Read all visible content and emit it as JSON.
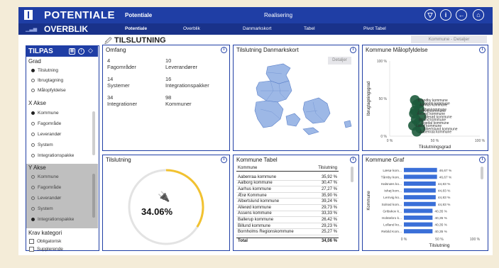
{
  "header": {
    "app_title": "POTENTIALE",
    "tabs": [
      {
        "label": "Potentiale",
        "active": true
      },
      {
        "label": "Realisering",
        "active": false
      }
    ],
    "icons": [
      "filter-icon",
      "info-icon",
      "back-icon",
      "home-icon"
    ]
  },
  "subheader": {
    "title": "OVERBLIK",
    "tabs": [
      {
        "label": "Potentiale",
        "active": true
      },
      {
        "label": "Overblik",
        "active": false
      },
      {
        "label": "Danmarkskort",
        "active": false
      },
      {
        "label": "Tabel",
        "active": false
      },
      {
        "label": "Pivot Tabel",
        "active": false
      }
    ]
  },
  "kommune_detaljer_label": "Kommune - Detaljer",
  "section_title": "TILSLUTNING",
  "sidebar": {
    "title": "TILPAS",
    "grad": {
      "title": "Grad",
      "options": [
        {
          "label": "Tilslutning",
          "selected": true
        },
        {
          "label": "Ibrugtagning",
          "selected": false
        },
        {
          "label": "Målopfyldelse",
          "selected": false
        }
      ]
    },
    "x_akse": {
      "title": "X Akse",
      "options": [
        {
          "label": "Kommune",
          "selected": true
        },
        {
          "label": "Fagområde",
          "selected": false
        },
        {
          "label": "Leverandør",
          "selected": false
        },
        {
          "label": "System",
          "selected": false
        },
        {
          "label": "Integrationspakke",
          "selected": false
        }
      ]
    },
    "y_akse": {
      "title": "Y Akse",
      "options": [
        {
          "label": "Kommune",
          "selected": false
        },
        {
          "label": "Fagområde",
          "selected": false
        },
        {
          "label": "Leverandør",
          "selected": false
        },
        {
          "label": "System",
          "selected": false
        },
        {
          "label": "Integrationspakke",
          "selected": true
        }
      ]
    },
    "krav": {
      "title": "Krav kategori",
      "options": [
        {
          "label": "Obligatorisk",
          "checked": false
        },
        {
          "label": "Supplerende",
          "checked": false
        }
      ]
    }
  },
  "omfang": {
    "title": "Omfang",
    "items": [
      {
        "value": "4",
        "label": "Fagområder"
      },
      {
        "value": "10",
        "label": "Leverandører"
      },
      {
        "value": "14",
        "label": "Systemer"
      },
      {
        "value": "16",
        "label": "Integrationspakker"
      },
      {
        "value": "34",
        "label": "Integrationer"
      },
      {
        "value": "98",
        "label": "Kommuner"
      }
    ]
  },
  "danmarkskort": {
    "title": "Tilslutning Danmarkskort",
    "button": "Detaljer"
  },
  "maalopfyldelse": {
    "title": "Kommune Målopfyldelse",
    "chart_data": {
      "type": "scatter",
      "xlabel": "Tilslutningsgrad",
      "ylabel": "Ibrugtagningsgrad",
      "xticks": [
        "0 %",
        "50 %",
        "100 %"
      ],
      "yticks": [
        "0 %",
        "50 %",
        "100 %"
      ],
      "xlim": [
        0,
        100
      ],
      "ylim": [
        0,
        100
      ],
      "labels": [
        "Brøndby kommune",
        "Aarhus kommune",
        "Ishøj kommune",
        "Assens kommune",
        "Allerød kommune",
        "Billund kommune",
        "Egedal kommune",
        "Læsø kommune",
        "Albertslund kommune",
        "Aabenraa kommune",
        "Lemvig kommune",
        "Egedal kommune"
      ],
      "points": [
        {
          "x": 28,
          "y": 48
        },
        {
          "x": 30,
          "y": 42
        },
        {
          "x": 33,
          "y": 36
        },
        {
          "x": 27,
          "y": 30
        },
        {
          "x": 35,
          "y": 26
        },
        {
          "x": 29,
          "y": 22
        },
        {
          "x": 32,
          "y": 18
        },
        {
          "x": 26,
          "y": 14
        },
        {
          "x": 34,
          "y": 10
        },
        {
          "x": 30,
          "y": 6
        },
        {
          "x": 28,
          "y": 34
        },
        {
          "x": 33,
          "y": 44
        }
      ]
    }
  },
  "tilslutning": {
    "title": "Tilslutning",
    "value": "34.06%",
    "fraction": 0.3406
  },
  "kommune_tabel": {
    "title": "Kommune Tabel",
    "headers": [
      "Kommune",
      "Tilslutning"
    ],
    "rows": [
      [
        "Aabenraa kommune",
        "35,92 %"
      ],
      [
        "Aalborg kommune",
        "30,47 %"
      ],
      [
        "Aarhus kommune",
        "27,27 %"
      ],
      [
        "Ærø Kommune",
        "35,90 %"
      ],
      [
        "Albertslund kommune",
        "39,24 %"
      ],
      [
        "Allerød kommune",
        "29,73 %"
      ],
      [
        "Assens kommune",
        "33,33 %"
      ],
      [
        "Ballerup kommune",
        "26,42 %"
      ],
      [
        "Billund kommune",
        "29,23 %"
      ],
      [
        "Bornholms Regionskommune",
        "25,27 %"
      ]
    ],
    "total": [
      "Total",
      "34,06 %"
    ]
  },
  "kommune_graf": {
    "title": "Kommune Graf",
    "chart_data": {
      "type": "bar",
      "orientation": "horizontal",
      "ylabel": "Kommune",
      "xlabel": "Tilslutning",
      "xticks": [
        "0 %",
        "50 %",
        "100 %"
      ],
      "xlim": [
        0,
        100
      ],
      "categories": [
        "Læsø kom...",
        "Tårnby kom...",
        "Halsnæs ko...",
        "Ishøj kom...",
        "Lemvig ko...",
        "Solrød kom...",
        "Gribskov k...",
        "Holstebro k...",
        "Lolland ko...",
        "Rebild Kom..."
      ],
      "values": [
        46.67,
        46.67,
        44.83,
        44.83,
        44.83,
        44.83,
        40.35,
        40.35,
        40.35,
        40.35
      ],
      "value_labels": [
        "46,67 %",
        "46,67 %",
        "44,83 %",
        "44,83 %",
        "44,83 %",
        "44,83 %",
        "40,35 %",
        "40,35 %",
        "40,35 %",
        "40,35 %"
      ],
      "bar_color": "#3a6fd8"
    }
  },
  "colors": {
    "primary": "#1f3ea5",
    "dark": "#19328a",
    "gauge": "#f2c230",
    "scatter": "#1d5b3c",
    "map": "#9db8e6"
  }
}
